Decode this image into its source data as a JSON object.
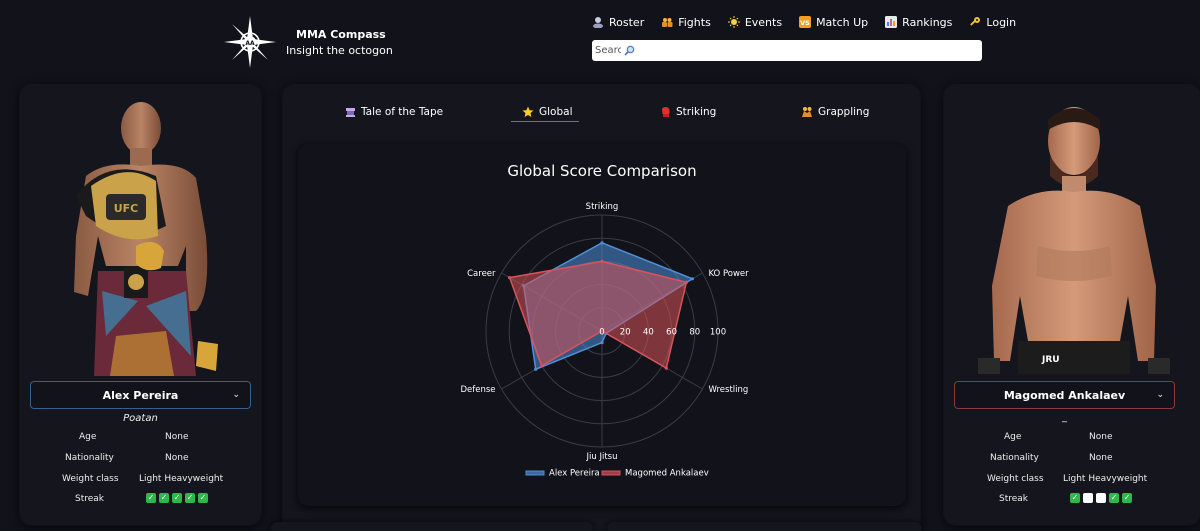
{
  "brand": {
    "title": "MMA Compass",
    "subtitle": "Insight the octogon"
  },
  "nav": {
    "items": [
      {
        "label": "Roster",
        "icon": "roster-icon"
      },
      {
        "label": "Fights",
        "icon": "fights-icon"
      },
      {
        "label": "Events",
        "icon": "events-icon"
      },
      {
        "label": "Match Up",
        "icon": "vs-icon"
      },
      {
        "label": "Rankings",
        "icon": "rankings-icon"
      },
      {
        "label": "Login",
        "icon": "key-icon"
      }
    ]
  },
  "search": {
    "placeholder": "Search",
    "icon": "search-icon"
  },
  "tabs": [
    {
      "label": "Tale of the Tape",
      "icon": "tape-icon"
    },
    {
      "label": "Global",
      "icon": "star-icon",
      "active": true
    },
    {
      "label": "Striking",
      "icon": "boxing-glove-icon"
    },
    {
      "label": "Grappling",
      "icon": "grappling-icon"
    }
  ],
  "left_fighter": {
    "name": "Alex Pereira",
    "nickname": "Poatan",
    "border_color": "#3a5f8a",
    "labels": {
      "age": "Age",
      "nationality": "Nationality",
      "weight_class": "Weight class",
      "streak": "Streak"
    },
    "age": "None",
    "nationality": "None",
    "weight_class": "Light Heavyweight",
    "streak": [
      "win",
      "win",
      "win",
      "win",
      "win"
    ]
  },
  "right_fighter": {
    "name": "Magomed Ankalaev",
    "nickname": "_",
    "border_color": "#8a3a3a",
    "labels": {
      "age": "Age",
      "nationality": "Nationality",
      "weight_class": "Weight class",
      "streak": "Streak"
    },
    "age": "None",
    "nationality": "None",
    "weight_class": "Light Heavyweight",
    "streak": [
      "win",
      "blank",
      "blank",
      "win",
      "win"
    ]
  },
  "chart_data": {
    "type": "radar",
    "title": "Global Score Comparison",
    "axes": [
      "Striking",
      "KO Power",
      "Wrestling",
      "Jiu Jitsu",
      "Defense",
      "Career"
    ],
    "r_ticks": [
      "0",
      "20",
      "40",
      "60",
      "80",
      "100"
    ],
    "rlim": [
      0,
      100
    ],
    "legend_position": "bottom",
    "series": [
      {
        "name": "Alex Pereira",
        "values": [
          76,
          90,
          4,
          10,
          66,
          78
        ],
        "color": "#4f8fd9"
      },
      {
        "name": "Magomed Ankalaev",
        "values": [
          60,
          84,
          64,
          0,
          60,
          92
        ],
        "color": "#d9535a"
      }
    ]
  },
  "colors": {
    "background": "#11121a",
    "card": "#14151d",
    "accent": "#e04242"
  }
}
